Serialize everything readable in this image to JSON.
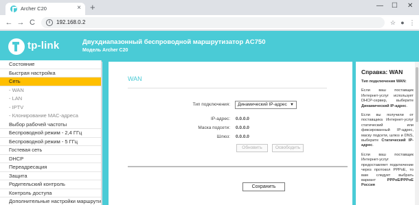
{
  "browser": {
    "tab_title": "Archer C20",
    "url": "192.168.0.2",
    "tab_close": "×",
    "new_tab": "+",
    "win_minimize": "—",
    "win_maximize": "☐",
    "win_close": "✕",
    "back": "←",
    "forward": "→",
    "reload": "C",
    "omni_icon": "i"
  },
  "header": {
    "logo": "tp-link",
    "title": "Двухдиапазонный беспроводной маршрутизатор AC750",
    "subtitle": "Модель Archer C20",
    "brand_color": "#4acbd6"
  },
  "sidebar": {
    "items": [
      {
        "label": "Состояние",
        "type": "main",
        "active": false
      },
      {
        "label": "Быстрая настройка",
        "type": "main",
        "active": false
      },
      {
        "label": "Сеть",
        "type": "main",
        "active": true
      },
      {
        "label": "- WAN",
        "type": "sub",
        "active": false
      },
      {
        "label": "- LAN",
        "type": "sub",
        "active": false
      },
      {
        "label": "- IPTV",
        "type": "sub",
        "active": false
      },
      {
        "label": "- Клонирование MAC-адреса",
        "type": "sub",
        "active": false
      },
      {
        "label": "Выбор рабочей частоты",
        "type": "main",
        "active": false
      },
      {
        "label": "Беспроводной режим - 2,4 ГГц",
        "type": "main",
        "active": false
      },
      {
        "label": "Беспроводной режим - 5 ГГц",
        "type": "main",
        "active": false
      },
      {
        "label": "Гостевая сеть",
        "type": "main",
        "active": false
      },
      {
        "label": "DHCP",
        "type": "main",
        "active": false
      },
      {
        "label": "Переадресация",
        "type": "main",
        "active": false
      },
      {
        "label": "Защита",
        "type": "main",
        "active": false
      },
      {
        "label": "Родительский контроль",
        "type": "main",
        "active": false
      },
      {
        "label": "Контроль доступа",
        "type": "main",
        "active": false
      },
      {
        "label": "Дополнительные настройки маршрутизации",
        "type": "main",
        "active": false
      }
    ]
  },
  "main": {
    "title": "WAN",
    "connection_type_label": "Тип подключения:",
    "connection_type_value": "Динамический IP-адрес",
    "ip_label": "IP-адрес:",
    "ip_value": "0.0.0.0",
    "mask_label": "Маска подсети:",
    "mask_value": "0.0.0.0",
    "gateway_label": "Шлюз:",
    "gateway_value": "0.0.0.0",
    "renew_label": "Обновить",
    "release_label": "Освободить",
    "save_label": "Сохранить"
  },
  "help": {
    "title": "Справка: WAN",
    "p1_a": "Тип подключения WAN:",
    "p2_a": "Если ваш поставщик Интернет-услуг использует DHCP-сервер, выберите ",
    "p2_b": "Динамический IP-адрес",
    "p3_a": "Если вы получили от поставщика Интернет-услуг статический или фиксированный IP-адрес, маску подсети, шлюз и DNS, выберите ",
    "p3_b": "Статический IP-адрес",
    "p4_a": "Если ваш поставщик Интернет-услуг предоставляет подключение через протокол PPPoE, то вам следует выбрать вариант ",
    "p4_b": "PPPoE/PPPoE Россия"
  }
}
